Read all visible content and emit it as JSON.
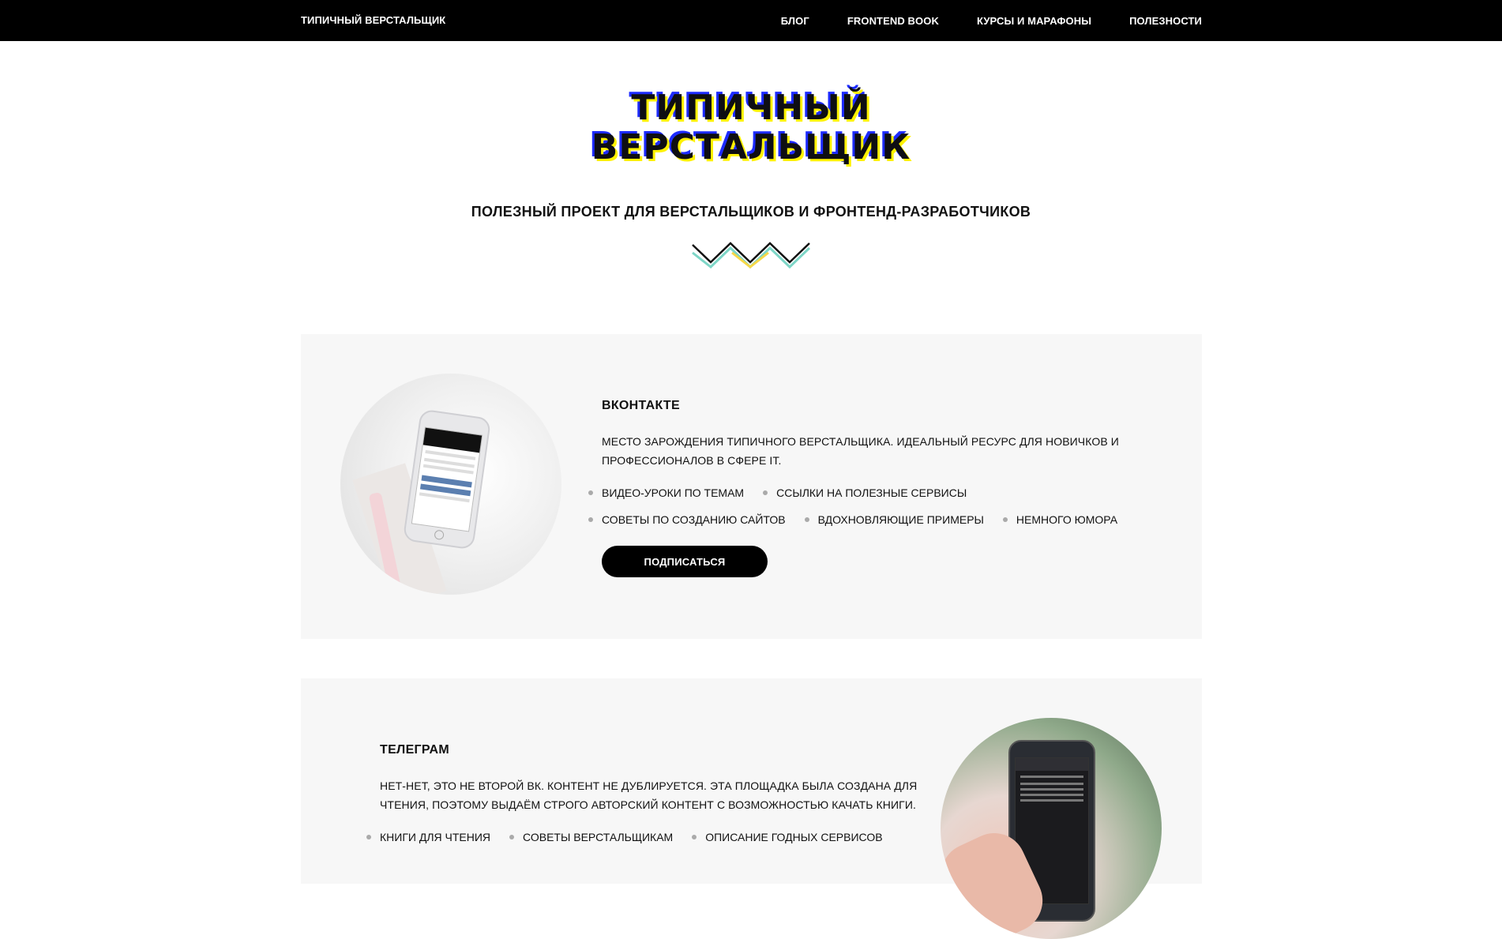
{
  "nav": {
    "brand": "ТИПИЧНЫЙ ВЕРСТАЛЬЩИК",
    "items": [
      {
        "label": "БЛОГ"
      },
      {
        "label": "FRONTEND BOOK"
      },
      {
        "label": "КУРСЫ И МАРАФОНЫ"
      },
      {
        "label": "ПОЛЕЗНОСТИ"
      }
    ]
  },
  "hero": {
    "logo_line1": "ТИПИЧНЫЙ",
    "logo_line2": "ВЕРСТАЛЬЩИК",
    "tagline": "ПОЛЕЗНЫЙ ПРОЕКТ ДЛЯ ВЕРСТАЛЬЩИКОВ И ФРОНТЕНД-РАЗРАБОТЧИКОВ"
  },
  "vk": {
    "title": "ВКОНТАКТЕ",
    "description": "МЕСТО ЗАРОЖДЕНИЯ ТИПИЧНОГО ВЕРСТАЛЬЩИКА. ИДЕАЛЬНЫЙ РЕСУРС ДЛЯ НОВИЧКОВ И ПРОФЕССИОНАЛОВ В СФЕРЕ IT.",
    "tags": [
      "ВИДЕО-УРОКИ ПО ТЕМАМ",
      "ССЫЛКИ НА ПОЛЕЗНЫЕ СЕРВИСЫ",
      "СОВЕТЫ ПО СОЗДАНИЮ САЙТОВ",
      "ВДОХНОВЛЯЮЩИЕ ПРИМЕРЫ",
      "НЕМНОГО ЮМОРА"
    ],
    "button": "ПОДПИСАТЬСЯ"
  },
  "telegram": {
    "title": "ТЕЛЕГРАМ",
    "description": "НЕТ-НЕТ, ЭТО НЕ ВТОРОЙ ВК. КОНТЕНТ НЕ ДУБЛИРУЕТСЯ. ЭТА ПЛОЩАДКА БЫЛА СОЗДАНА ДЛЯ ЧТЕНИЯ, ПОЭТОМУ ВЫДАЁМ СТРОГО АВТОРСКИЙ КОНТЕНТ С ВОЗМОЖНОСТЬЮ КАЧАТЬ КНИГИ.",
    "tags": [
      "КНИГИ ДЛЯ ЧТЕНИЯ",
      "СОВЕТЫ ВЕРСТАЛЬЩИКАМ",
      "ОПИСАНИЕ ГОДНЫХ СЕРВИСОВ"
    ]
  },
  "colors": {
    "nav_bg": "#000000",
    "card_bg": "#f7f7f7",
    "logo_yellow": "#fff200",
    "logo_blue": "#1d2bff",
    "zigzag_teal": "#7ed6c7",
    "zigzag_yellow": "#f7d84a"
  }
}
